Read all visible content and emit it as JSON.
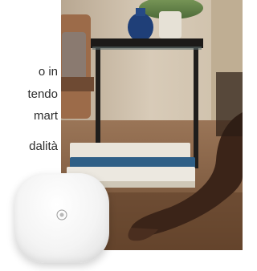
{
  "promo_text": {
    "lines": [
      "o in",
      "tendo",
      "mart",
      "dalità"
    ]
  },
  "photo": {
    "icon": "lifestyle-photo",
    "alt": ""
  },
  "device": {
    "icon": "smart-hub-icon"
  }
}
